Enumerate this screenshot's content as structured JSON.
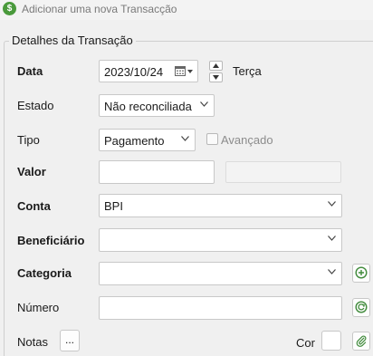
{
  "window": {
    "title": "Adicionar uma nova Transacção",
    "icon": "dollar-icon"
  },
  "group": {
    "title": "Detalhes da Transação"
  },
  "labels": {
    "data": "Data",
    "estado": "Estado",
    "tipo": "Tipo",
    "valor": "Valor",
    "conta": "Conta",
    "beneficiario": "Beneficiário",
    "categoria": "Categoria",
    "numero": "Número",
    "notas": "Notas",
    "cor": "Cor"
  },
  "date": {
    "value": "2023/10/24",
    "weekday": "Terça"
  },
  "estado": {
    "selected": "Não reconciliada"
  },
  "tipo": {
    "selected": "Pagamento"
  },
  "avancado": {
    "label": "Avançado",
    "checked": false
  },
  "valor": {
    "value": ""
  },
  "conta": {
    "selected": "BPI"
  },
  "beneficiario": {
    "selected": ""
  },
  "categoria": {
    "selected": ""
  },
  "numero": {
    "value": ""
  },
  "notas": {
    "button_label": "..."
  },
  "colors": {
    "accent_green": "#4a9a3c",
    "border": "#c8c8c8",
    "background": "#f0f0f0"
  }
}
